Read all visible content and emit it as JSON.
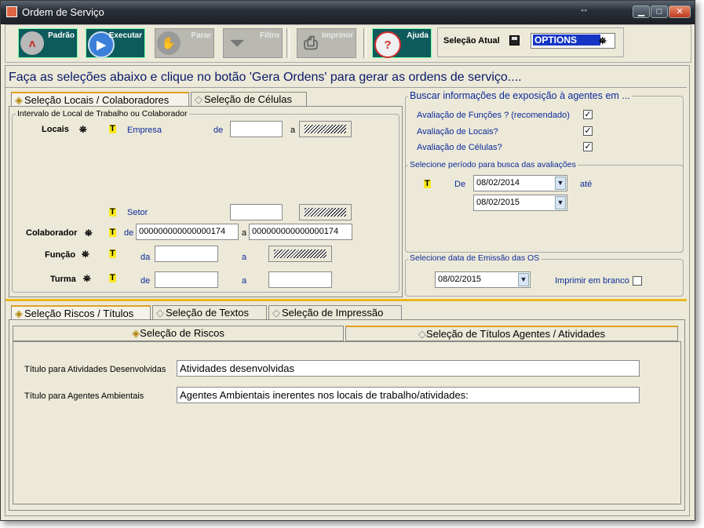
{
  "window": {
    "title": "Ordem de Serviço",
    "resize_glyph": "↔",
    "min_glyph": "▁",
    "max_glyph": "□",
    "close_glyph": "✕"
  },
  "toolbar": {
    "buttons": [
      {
        "label": "Padrão",
        "icon": "padrao-icon",
        "glyph": "ᴧ",
        "color": "#c0302a",
        "enabled": true
      },
      {
        "label": "Executar",
        "icon": "play-icon",
        "glyph": "▶",
        "color": "#3a7fd8",
        "enabled": true
      },
      {
        "label": "Parar",
        "icon": "stop-hand-icon",
        "glyph": "✋",
        "color": "#8a8a8a",
        "enabled": false
      },
      {
        "label": "Filtro",
        "icon": "funnel-icon",
        "glyph": "⏷",
        "color": "#8a8a8a",
        "enabled": false
      },
      {
        "label": "Imprimir",
        "icon": "printer-icon",
        "glyph": "⎙",
        "color": "#8a8a8a",
        "enabled": false
      },
      {
        "label": "Ajuda",
        "icon": "help-magnifier-icon",
        "glyph": "?",
        "color": "#d03030",
        "enabled": true
      }
    ],
    "selecao_atual_label": "Seleção Atual",
    "selecao_atual_value": "OPTIONS",
    "binoculars_glyph": "🔭"
  },
  "headline": "Faça as seleções abaixo e clique no botão 'Gera Ordens' para gerar as ordens de serviço....",
  "top_tabs": [
    {
      "label": "Seleção Locais / Colaboradores",
      "active": true
    },
    {
      "label": "Seleção de Células",
      "active": false
    }
  ],
  "intervalo": {
    "legend": "Intervalo de  Local de Trabalho ou Colaborador",
    "locais_label": "Locais",
    "empresa_label": "Empresa",
    "de_label": "de",
    "a_label": "a",
    "da_label": "da",
    "setor_label": "Setor",
    "colaborador_label": "Colaborador",
    "colaborador_de": "000000000000000174",
    "colaborador_a": "000000000000000174",
    "funcao_label": "Função",
    "turma_label": "Turma",
    "t_glyph": "T",
    "binoc_glyph": "🔭"
  },
  "buscar": {
    "legend": "Buscar informações de exposição à agentes em ...",
    "items": [
      {
        "label": "Avaliação de Funções ? (recomendado)",
        "checked": true
      },
      {
        "label": "Avaliação de Locais?",
        "checked": true
      },
      {
        "label": "Avaliação de Células?",
        "checked": true
      }
    ],
    "check_glyph": "✓"
  },
  "periodo": {
    "legend": "Selecione período para busca das avaliações",
    "de_label": "De",
    "ate_label": "até",
    "date_from": "08/02/2014",
    "date_to": "08/02/2015",
    "t_glyph": "T",
    "combo_glyph": "▼"
  },
  "emissao": {
    "legend": "Selecione data de Emissão das OS",
    "date": "08/02/2015",
    "imprimir_branco_label": "Imprimir em branco",
    "imprimir_branco_checked": false
  },
  "bottom_tabs": [
    {
      "label": "Seleção Riscos / Títulos",
      "active": true
    },
    {
      "label": "Seleção de Textos",
      "active": false
    },
    {
      "label": "Seleção de Impressão",
      "active": false
    }
  ],
  "sub_tabs": [
    {
      "label": "Seleção de Riscos",
      "active": false
    },
    {
      "label": "Seleção de Títulos Agentes / Atividades",
      "active": true
    }
  ],
  "titulos": {
    "atividades_label": "Título para Atividades Desenvolvidas",
    "atividades_value": "Atividades desenvolvidas",
    "agentes_label": "Título para Agentes Ambientais",
    "agentes_value": "Agentes Ambientais inerentes nos locais de trabalho/atividades:"
  },
  "colors": {
    "toolbar_button": "#0d5b5b",
    "headline": "#0a1a6a",
    "selection_highlight": "#1535c4",
    "tab_accent": "#e0a020"
  }
}
